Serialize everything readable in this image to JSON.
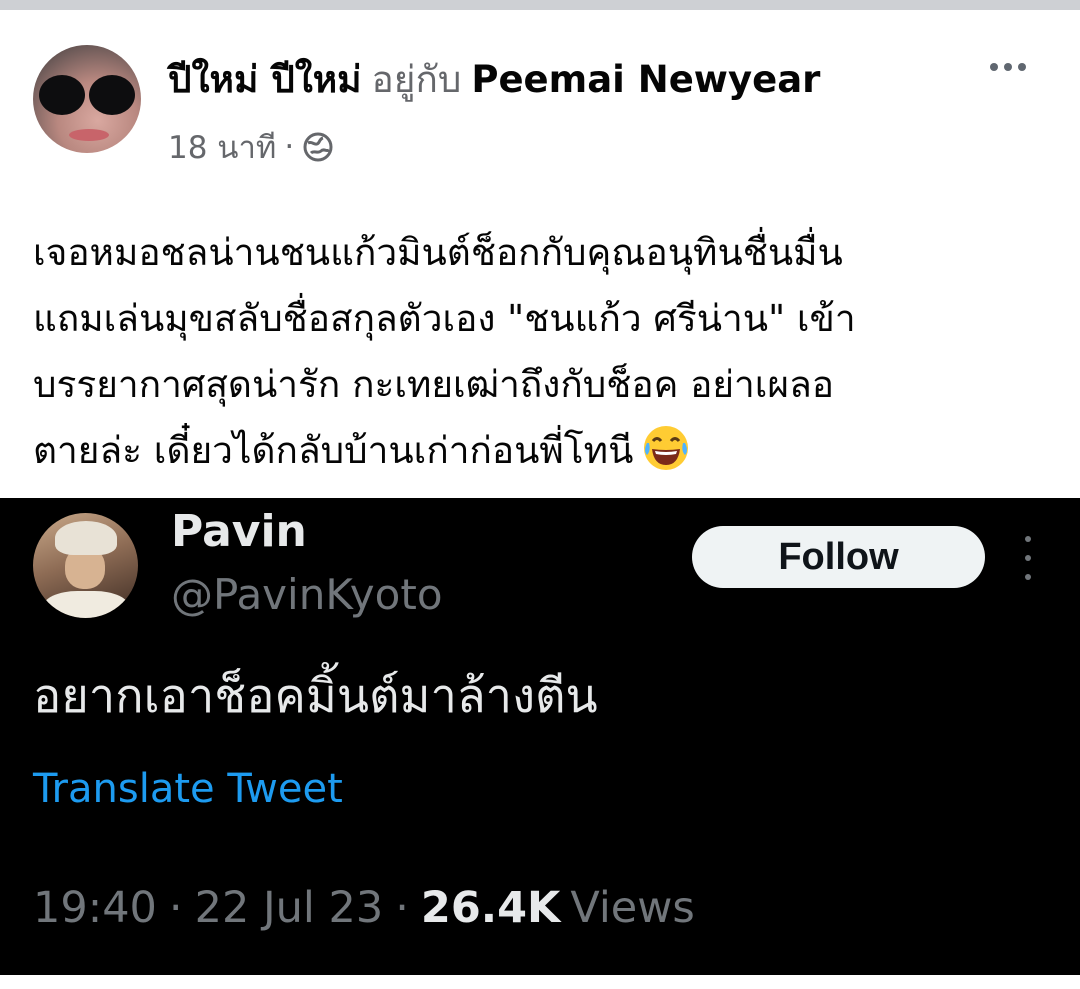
{
  "post": {
    "author_name": "ปีใหม่ ปีใหม่",
    "with_text": "อยู่กับ",
    "tagged_name": "Peemai Newyear",
    "time_ago": "18 นาที",
    "meta_separator": "·",
    "privacy_icon": "globe-icon",
    "more_icon": "more-horizontal-icon",
    "text_lines": [
      "เจอหมอชลน่านชนแก้วมินต์ช็อกกับคุณอนุทินชื่นมื่น",
      "แถมเล่นมุขสลับชื่อสกุลตัวเอง \"ชนแก้ว ศรีน่าน\" เข้า",
      "บรรยากาศสุดน่ารัก กะเทยเฒ่าถึงกับช็อค อย่าเผลอ",
      "ตายล่ะ เดี๋ยวได้กลับบ้านเก่าก่อนพี่โทนี"
    ],
    "emoji_icon": "laughing-tears-emoji-icon"
  },
  "tweet": {
    "name": "Pavin",
    "handle": "@PavinKyoto",
    "follow_label": "Follow",
    "more_icon": "more-vertical-icon",
    "text": "อยากเอาช็อคมิ้นต์มาล้างตีน",
    "translate_label": "Translate Tweet",
    "time": "19:40",
    "separator": "·",
    "date": "22 Jul 23",
    "views_count": "26.4K",
    "views_label": "Views"
  },
  "colors": {
    "primary_text": "#050505",
    "secondary_text": "#65676b",
    "tweet_background": "#000000",
    "tweet_text": "#e7e9ea",
    "tweet_secondary": "#71767b",
    "link_blue": "#1d9bf0",
    "follow_button_bg": "#eff3f4"
  }
}
